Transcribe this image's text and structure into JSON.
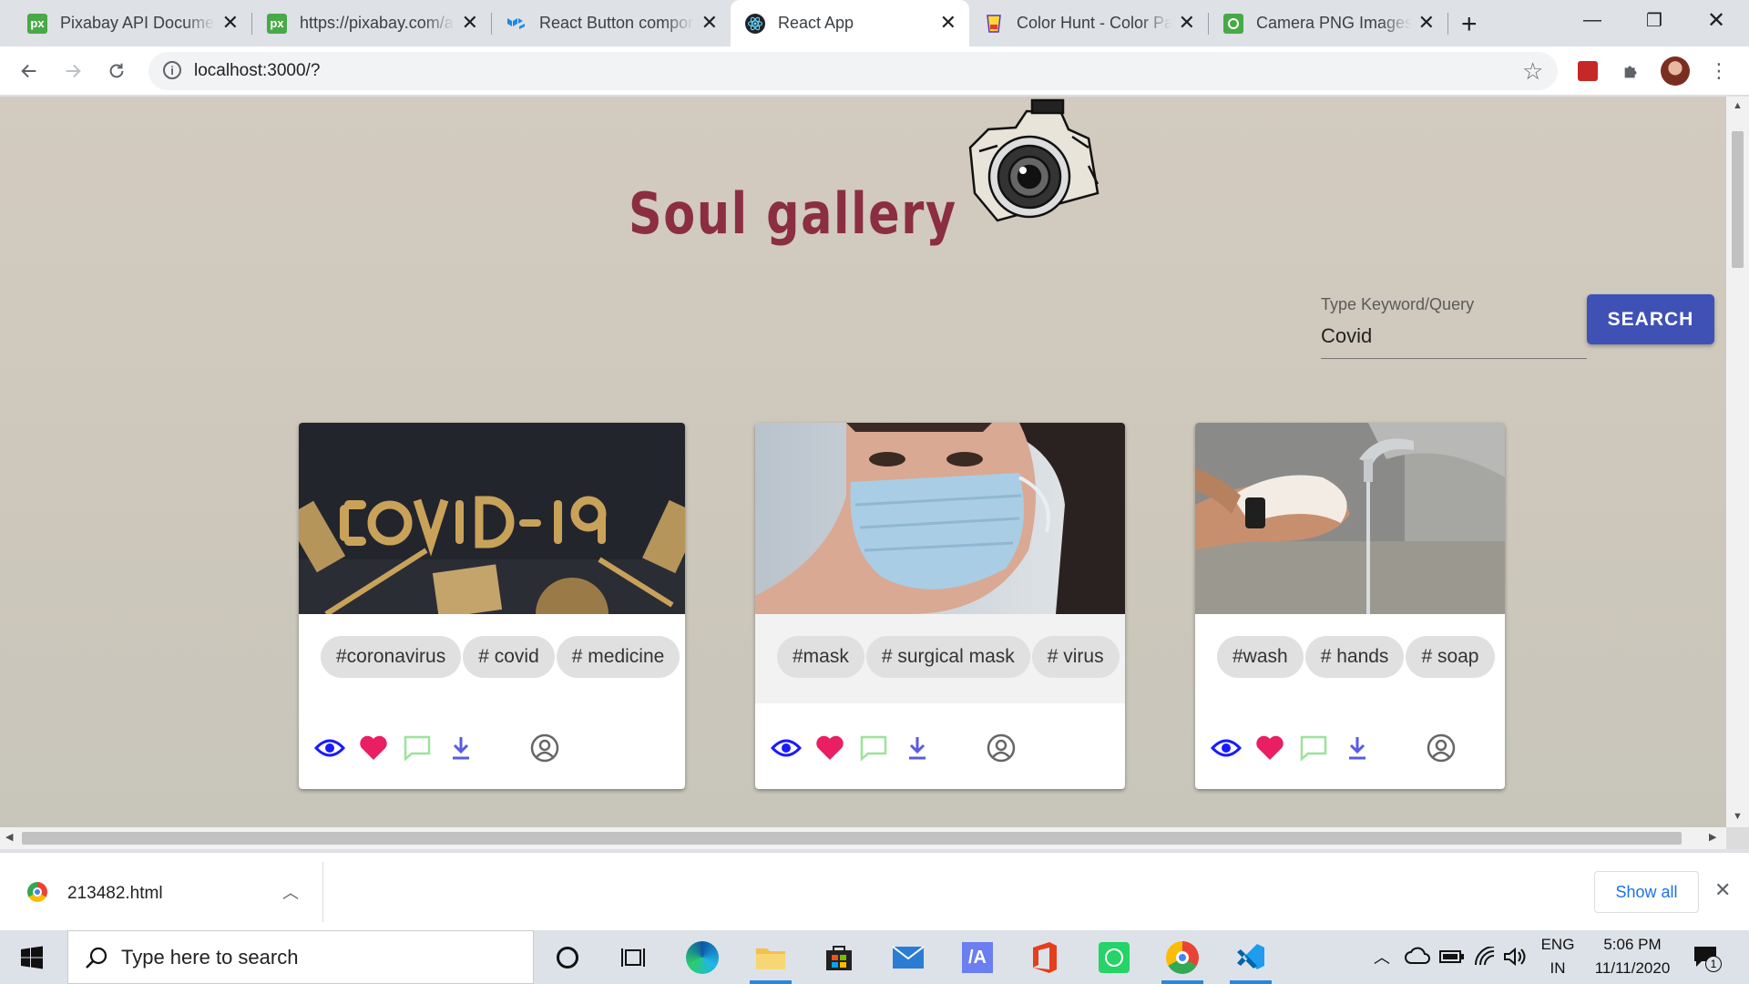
{
  "browser": {
    "tabs": [
      {
        "title": "Pixabay API Documentation",
        "icon": "pixabay-icon",
        "active": false
      },
      {
        "title": "https://pixabay.com/api/",
        "icon": "pixabay-icon",
        "active": false
      },
      {
        "title": "React Button component",
        "icon": "mui-icon",
        "active": false
      },
      {
        "title": "React App",
        "icon": "react-icon",
        "active": true
      },
      {
        "title": "Color Hunt - Color Palettes",
        "icon": "colorhunt-icon",
        "active": false
      },
      {
        "title": "Camera PNG Images",
        "icon": "pngtree-icon",
        "active": false
      }
    ],
    "url": "localhost:3000/?"
  },
  "app": {
    "title": "Soul gallery",
    "search": {
      "label": "Type Keyword/Query",
      "value": "Covid",
      "button": "SEARCH"
    },
    "cards": [
      {
        "image": "covid-19 letters made of pills",
        "tags": [
          "#coronavirus",
          "# covid",
          "# medicine"
        ]
      },
      {
        "image": "woman wearing surgical mask",
        "tags": [
          "#mask",
          "# surgical mask",
          "# virus"
        ]
      },
      {
        "image": "washing hands with soap",
        "tags": [
          "#wash",
          "# hands",
          "# soap"
        ]
      }
    ],
    "colors": {
      "title": "#8b2e42",
      "accent": "#3f51b5",
      "heart": "#e91e63",
      "eye": "#1a1aff",
      "comment": "#9be39b",
      "download": "#5a5ae0"
    }
  },
  "downloads": {
    "file": "213482.html",
    "show_all": "Show all"
  },
  "taskbar": {
    "search_placeholder": "Type here to search",
    "lang": "ENG",
    "region": "IN",
    "time": "5:06 PM",
    "date": "11/11/2020",
    "notif_count": "1"
  }
}
